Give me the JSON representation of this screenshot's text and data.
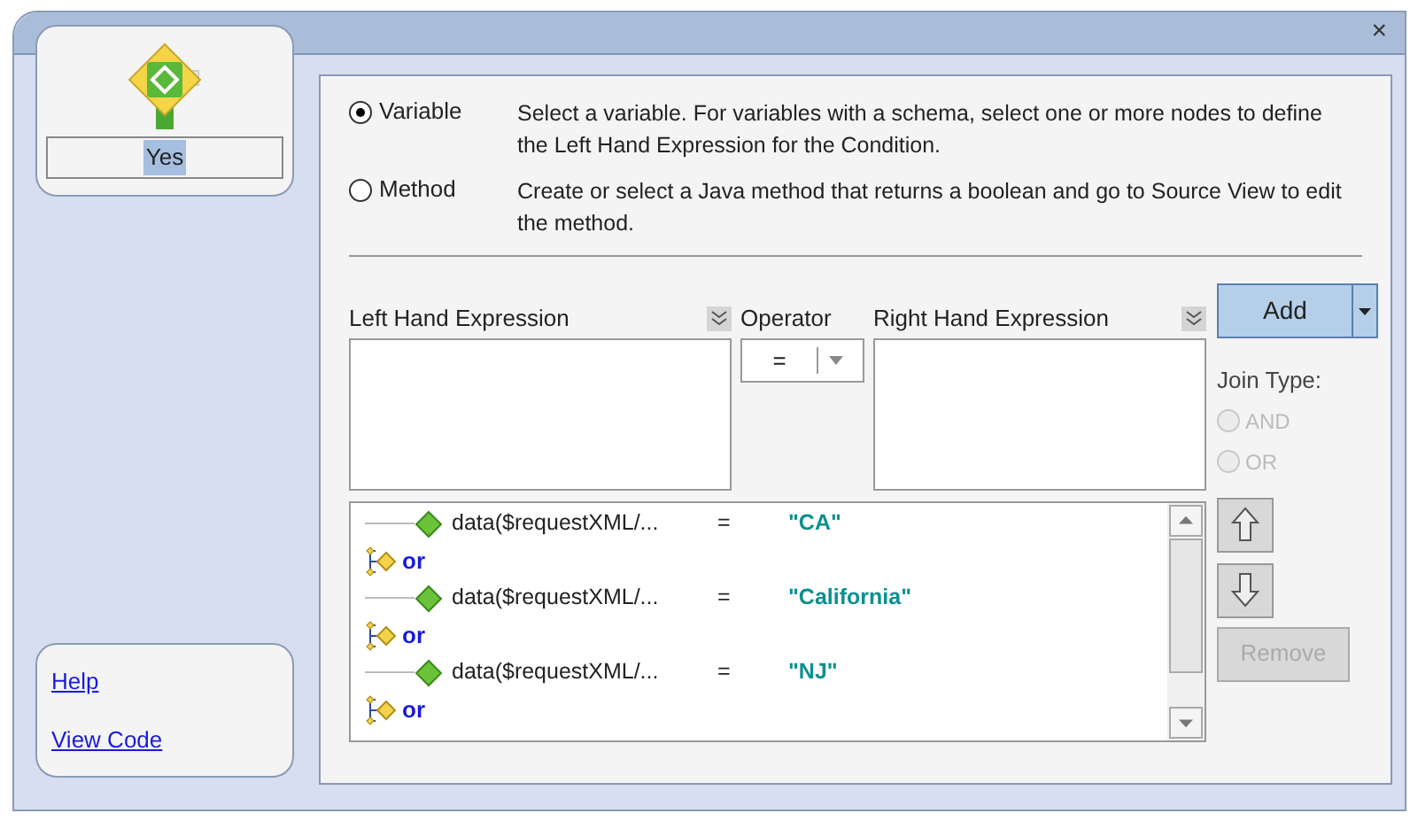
{
  "window": {
    "close": "×"
  },
  "node": {
    "label": "Yes",
    "selected": true
  },
  "links": [
    "Help",
    "View Code"
  ],
  "options": [
    {
      "label": "Variable",
      "selected": true,
      "description": "Select a variable. For variables with a schema, select one or more nodes to define the Left Hand Expression for the Condition."
    },
    {
      "label": "Method",
      "selected": false,
      "description": "Create or select a Java method that returns a boolean and go to Source View to edit the method."
    }
  ],
  "left_expression": {
    "label": "Left Hand Expression"
  },
  "operator": {
    "label": "Operator",
    "value": "="
  },
  "right_expression": {
    "label": "Right Hand Expression"
  },
  "add_button": {
    "label": "Add"
  },
  "join_type": {
    "label": "Join Type:",
    "options": [
      {
        "label": "AND",
        "selected": false,
        "disabled": true
      },
      {
        "label": "OR",
        "selected": false,
        "disabled": true
      }
    ]
  },
  "conditions": [
    {
      "kind": "condition",
      "left": "data($requestXML/...",
      "operator": "=",
      "right": "\"CA\""
    },
    {
      "kind": "join",
      "label": "or"
    },
    {
      "kind": "condition",
      "left": "data($requestXML/...",
      "operator": "=",
      "right": "\"California\""
    },
    {
      "kind": "join",
      "label": "or"
    },
    {
      "kind": "condition",
      "left": "data($requestXML/...",
      "operator": "=",
      "right": "\"NJ\""
    },
    {
      "kind": "join",
      "label": "or"
    }
  ],
  "remove_button": {
    "label": "Remove",
    "disabled": true
  }
}
